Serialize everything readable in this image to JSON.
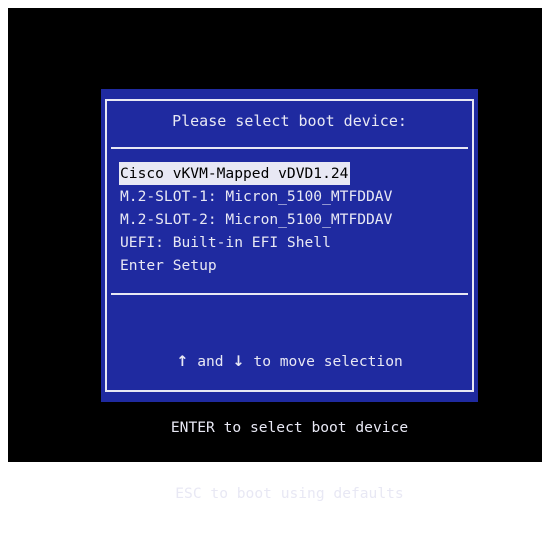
{
  "boot_menu": {
    "title": "Please select boot device:",
    "items": [
      {
        "label": "Cisco vKVM-Mapped vDVD1.24",
        "selected": true
      },
      {
        "label": "M.2-SLOT-1: Micron_5100_MTFDDAV",
        "selected": false
      },
      {
        "label": "M.2-SLOT-2: Micron_5100_MTFDDAV",
        "selected": false
      },
      {
        "label": "UEFI: Built-in EFI Shell",
        "selected": false
      },
      {
        "label": "Enter Setup",
        "selected": false
      }
    ],
    "help": {
      "up_arrow": "↑",
      "and_text": " and ",
      "down_arrow": "↓",
      "move_text": " to move selection",
      "enter_line": "ENTER to select boot device",
      "esc_line": "ESC to boot using defaults"
    }
  },
  "colors": {
    "screen_background": "#000000",
    "dialog_background": "#1f2aa0",
    "text": "#e8e8f4",
    "selection_background": "#e8e8f4",
    "selection_text": "#000000"
  }
}
